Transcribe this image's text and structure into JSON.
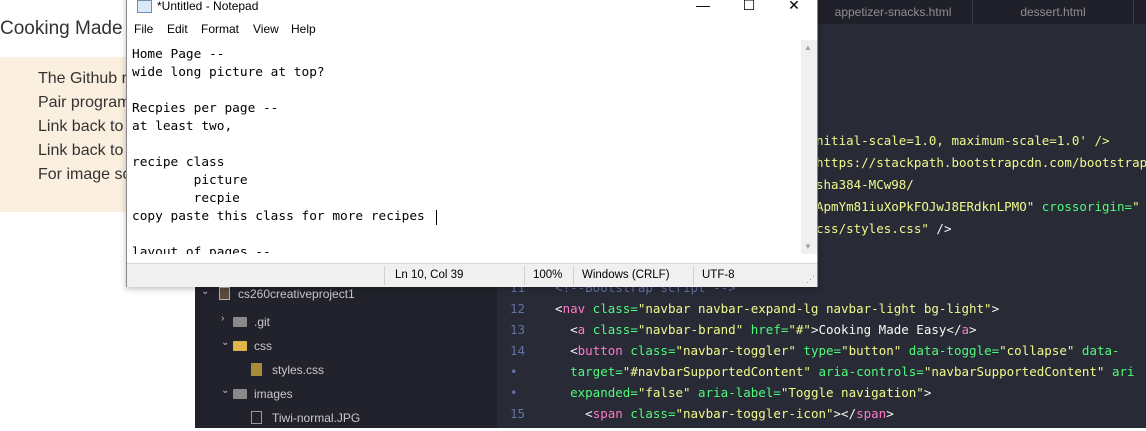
{
  "browser": {
    "brand": "Cooking Made",
    "lines": [
      "The Github r",
      "Pair program",
      "Link back to",
      "Link back to",
      "For image sc"
    ]
  },
  "editor": {
    "tabs": [
      "appetizer-snacks.html",
      "dessert.html"
    ],
    "code_upper": [
      [
        {
          "t": "nitial-scale=1.0, maximum-scale=1.0' />",
          "c": "str"
        }
      ],
      [
        {
          "t": "https://stackpath.bootstrapcdn.com/bootstrap",
          "c": "str"
        }
      ],
      [
        {
          "t": "sha384-MCw98/",
          "c": "str"
        }
      ],
      [
        {
          "t": "ApmYm81iuXoPkFOJwJ8ERdknLPMO\"",
          "c": "str"
        },
        {
          "t": " crossorigin=",
          "c": "attr"
        },
        {
          "t": "\"",
          "c": "str"
        }
      ],
      [
        {
          "t": "css/styles.css\"",
          "c": "str"
        },
        {
          "t": " />",
          "c": "txt"
        }
      ]
    ],
    "code_lower": [
      {
        "num": "11",
        "segs": [
          {
            "t": "  <!--Bootstrap script -->",
            "c": "cmt"
          }
        ]
      },
      {
        "num": "12",
        "segs": [
          {
            "t": "  <",
            "c": "txt"
          },
          {
            "t": "nav",
            "c": "tag"
          },
          {
            "t": " class=",
            "c": "attr"
          },
          {
            "t": "\"navbar navbar-expand-lg navbar-light bg-light\"",
            "c": "str"
          },
          {
            "t": ">",
            "c": "txt"
          }
        ]
      },
      {
        "num": "13",
        "segs": [
          {
            "t": "    <",
            "c": "txt"
          },
          {
            "t": "a",
            "c": "tag"
          },
          {
            "t": " class=",
            "c": "attr"
          },
          {
            "t": "\"navbar-brand\"",
            "c": "str"
          },
          {
            "t": " href=",
            "c": "attr"
          },
          {
            "t": "\"#\"",
            "c": "str"
          },
          {
            "t": ">Cooking Made Easy</",
            "c": "txt"
          },
          {
            "t": "a",
            "c": "tag"
          },
          {
            "t": ">",
            "c": "txt"
          }
        ]
      },
      {
        "num": "14",
        "segs": [
          {
            "t": "    <",
            "c": "txt"
          },
          {
            "t": "button",
            "c": "tag"
          },
          {
            "t": " class=",
            "c": "attr"
          },
          {
            "t": "\"navbar-toggler\"",
            "c": "str"
          },
          {
            "t": " type=",
            "c": "attr"
          },
          {
            "t": "\"button\"",
            "c": "str"
          },
          {
            "t": " data-toggle=",
            "c": "attr"
          },
          {
            "t": "\"collapse\"",
            "c": "str"
          },
          {
            "t": " data-",
            "c": "attr"
          }
        ]
      },
      {
        "num": "•",
        "segs": [
          {
            "t": "    target=",
            "c": "attr"
          },
          {
            "t": "\"#navbarSupportedContent\"",
            "c": "str"
          },
          {
            "t": " aria-controls=",
            "c": "attr"
          },
          {
            "t": "\"navbarSupportedContent\"",
            "c": "str"
          },
          {
            "t": " ari",
            "c": "attr"
          }
        ]
      },
      {
        "num": "•",
        "segs": [
          {
            "t": "    expanded=",
            "c": "attr"
          },
          {
            "t": "\"false\"",
            "c": "str"
          },
          {
            "t": " aria-label=",
            "c": "attr"
          },
          {
            "t": "\"Toggle navigation\"",
            "c": "str"
          },
          {
            "t": ">",
            "c": "txt"
          }
        ]
      },
      {
        "num": "15",
        "segs": [
          {
            "t": "      <",
            "c": "txt"
          },
          {
            "t": "span",
            "c": "tag"
          },
          {
            "t": " class=",
            "c": "attr"
          },
          {
            "t": "\"navbar-toggler-icon\"",
            "c": "str"
          },
          {
            "t": "></",
            "c": "txt"
          },
          {
            "t": "span",
            "c": "tag"
          },
          {
            "t": ">",
            "c": "txt"
          }
        ]
      }
    ],
    "tree": [
      {
        "label": "cs260creativeproject1",
        "icon": "book-icon",
        "chevron": "⌄"
      },
      {
        "label": ".git",
        "icon": "folder-icon",
        "chevron": "›"
      },
      {
        "label": "css",
        "icon": "folder-icon",
        "chevron": "⌄"
      },
      {
        "label": "styles.css",
        "icon": "file-icon",
        "chevron": ""
      },
      {
        "label": "images",
        "icon": "folder-icon",
        "chevron": "⌄"
      },
      {
        "label": "Tiwi-normal.JPG",
        "icon": "image-file-icon",
        "chevron": ""
      }
    ]
  },
  "notepad": {
    "title": "*Untitled - Notepad",
    "controls": {
      "minimize": "—",
      "maximize": "☐",
      "close": "✕"
    },
    "menus": [
      "File",
      "Edit",
      "Format",
      "View",
      "Help"
    ],
    "lines": [
      "Home Page --",
      "wide long picture at top?",
      "",
      "Recpies per page --",
      "at least two,",
      "",
      "recipe class",
      "        picture",
      "        recpie",
      "copy paste this class for more recipes",
      "",
      "layout of pages --"
    ],
    "status": {
      "position": "Ln 10, Col 39",
      "zoom": "100%",
      "line_ending": "Windows (CRLF)",
      "encoding": "UTF-8"
    }
  }
}
